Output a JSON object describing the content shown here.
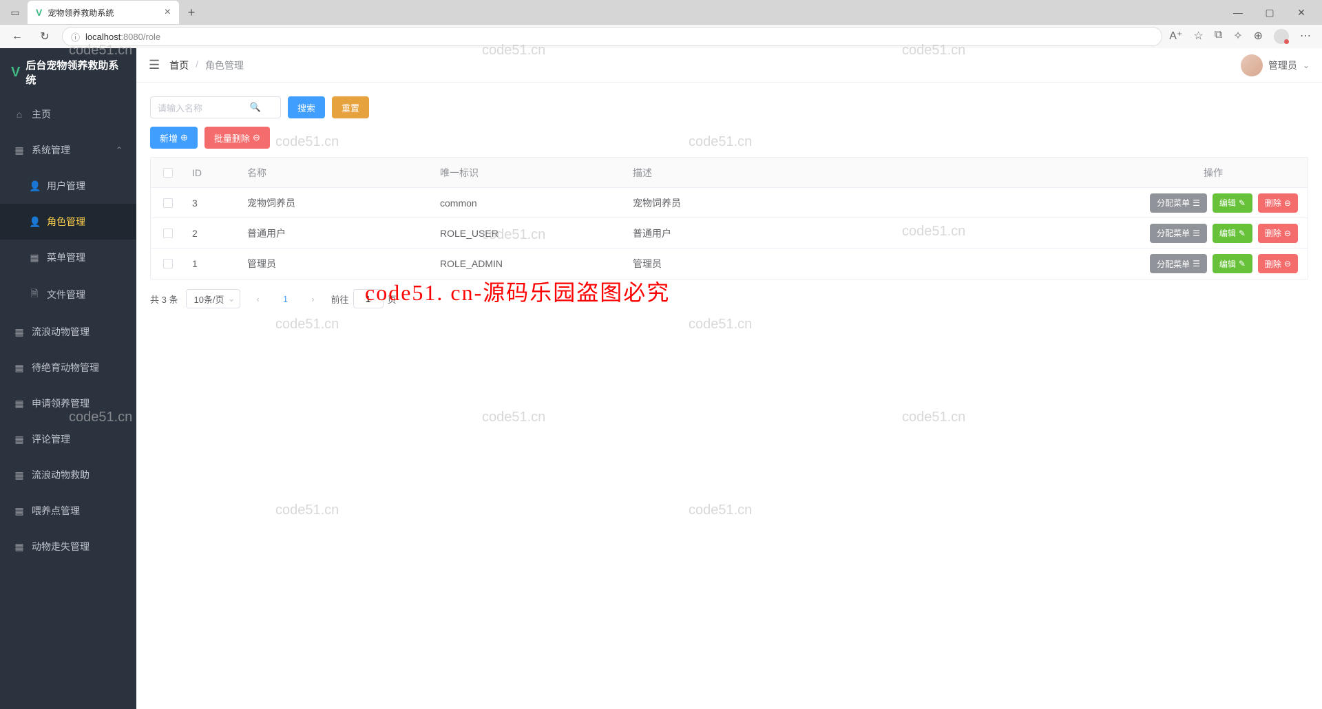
{
  "browser": {
    "tab_title": "宠物领养救助系统",
    "url_host": "localhost",
    "url_port": ":8080",
    "url_path": "/role"
  },
  "app": {
    "logo_text": "后台宠物领养救助系统"
  },
  "sidebar": {
    "items": [
      {
        "label": "主页",
        "icon": "home"
      },
      {
        "label": "系统管理",
        "icon": "grid",
        "expandable": true
      },
      {
        "label": "用户管理",
        "icon": "user",
        "sub": true
      },
      {
        "label": "角色管理",
        "icon": "user-solid",
        "sub": true,
        "active": true
      },
      {
        "label": "菜单管理",
        "icon": "grid",
        "sub": true
      },
      {
        "label": "文件管理",
        "icon": "doc",
        "sub": true
      },
      {
        "label": "流浪动物管理",
        "icon": "grid"
      },
      {
        "label": "待绝育动物管理",
        "icon": "grid"
      },
      {
        "label": "申请领养管理",
        "icon": "grid"
      },
      {
        "label": "评论管理",
        "icon": "grid"
      },
      {
        "label": "流浪动物救助",
        "icon": "grid"
      },
      {
        "label": "喂养点管理",
        "icon": "grid"
      },
      {
        "label": "动物走失管理",
        "icon": "grid"
      }
    ]
  },
  "header": {
    "breadcrumb_home": "首页",
    "breadcrumb_current": "角色管理",
    "user_name": "管理员"
  },
  "toolbar": {
    "search_placeholder": "请输入名称",
    "search_btn": "搜索",
    "reset_btn": "重置",
    "add_btn": "新增",
    "batch_delete_btn": "批量删除"
  },
  "table": {
    "headers": {
      "id": "ID",
      "name": "名称",
      "key": "唯一标识",
      "desc": "描述",
      "ops": "操作"
    },
    "rows": [
      {
        "id": "3",
        "name": "宠物饲养员",
        "key": "common",
        "desc": "宠物饲养员"
      },
      {
        "id": "2",
        "name": "普通用户",
        "key": "ROLE_USER",
        "desc": "普通用户"
      },
      {
        "id": "1",
        "name": "管理员",
        "key": "ROLE_ADMIN",
        "desc": "管理员"
      }
    ],
    "ops": {
      "assign": "分配菜单",
      "edit": "编辑",
      "delete": "删除"
    }
  },
  "pagination": {
    "total_text": "共 3 条",
    "page_size": "10条/页",
    "current": "1",
    "goto_prefix": "前往",
    "goto_value": "1",
    "goto_suffix": "页"
  },
  "watermark": {
    "text": "code51.cn",
    "big": "code51. cn-源码乐园盗图必究"
  }
}
